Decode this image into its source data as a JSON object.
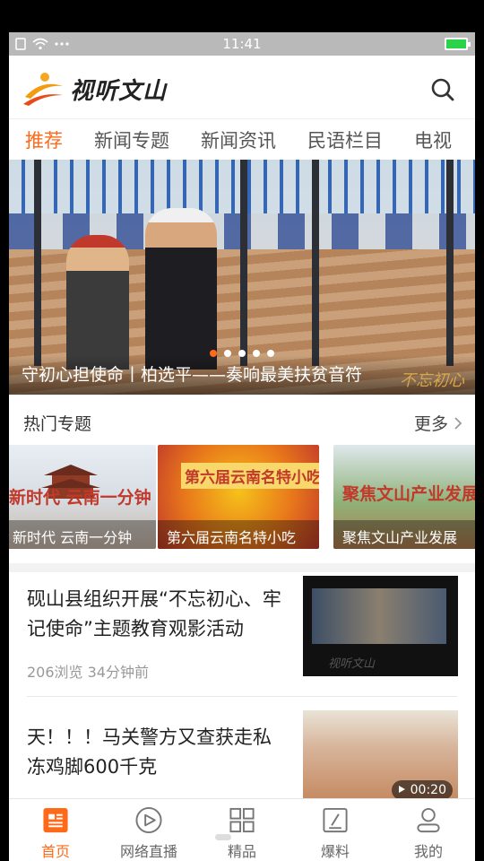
{
  "status_bar": {
    "time": "11:41"
  },
  "header": {
    "logo_text": "视听文山"
  },
  "tabs": [
    {
      "label": "推荐",
      "active": true
    },
    {
      "label": "新闻专题"
    },
    {
      "label": "新闻资讯"
    },
    {
      "label": "民语栏目"
    },
    {
      "label": "电视"
    }
  ],
  "banner": {
    "caption": "守初心担使命丨柏选平——奏响最美扶贫音符",
    "corner_text": "不忘初心",
    "slide_count": 5,
    "active_slide": 1
  },
  "hot_topics": {
    "title": "热门专题",
    "more": "更多",
    "items": [
      {
        "label": "新时代 云南一分钟",
        "overlay": "新时代 云南一分钟"
      },
      {
        "label": "第六届云南名特小吃",
        "overlay": "第六届云南名特小吃"
      },
      {
        "label": "聚焦文山产业发展",
        "overlay": "聚焦文山产业发展"
      }
    ]
  },
  "news": [
    {
      "title": "砚山县组织开展“不忘初心、牢记使命”主题教育观影活动",
      "meta": "206浏览  34分钟前",
      "thumb_watermark": "视听文山"
    },
    {
      "title": "天！！！马关警方又查获走私冻鸡脚600千克",
      "duration": "00:20"
    }
  ],
  "bottom_nav": [
    {
      "label": "首页",
      "icon": "home-icon",
      "active": true
    },
    {
      "label": "网络直播",
      "icon": "play-icon"
    },
    {
      "label": "精品",
      "icon": "grid-icon"
    },
    {
      "label": "爆料",
      "icon": "edit-icon"
    },
    {
      "label": "我的",
      "icon": "user-icon"
    }
  ],
  "colors": {
    "accent": "#ff6a1a"
  }
}
